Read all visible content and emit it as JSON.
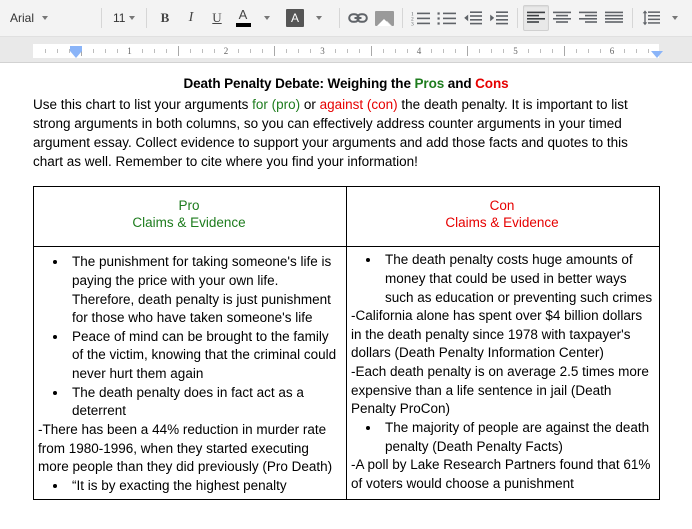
{
  "toolbar": {
    "font_name": "Arial",
    "font_size": "11",
    "bold_label": "B",
    "italic_label": "I",
    "underline_label": "U",
    "text_color_label": "A",
    "highlight_color_label": "A"
  },
  "ruler": {
    "numbers": [
      "1",
      "2",
      "3",
      "4",
      "5",
      "6"
    ]
  },
  "document": {
    "title_plain_1": "Death Penalty Debate: Weighing the ",
    "title_pros": "Pros",
    "title_plain_2": " and ",
    "title_cons": "Cons",
    "intro_1": "Use this chart to list your arguments ",
    "intro_pro": "for (pro)",
    "intro_2": " or ",
    "intro_con": "against (con)",
    "intro_3": " the death penalty. It is important to list strong arguments in both columns, so you can effectively address counter arguments in your timed argument essay. Collect evidence to support your arguments and add those facts and quotes to this chart as well. Remember to cite where you find your information!",
    "table": {
      "headers": [
        {
          "title": "Pro",
          "subtitle": "Claims & Evidence",
          "color": "#1e7c1e"
        },
        {
          "title": "Con",
          "subtitle": "Claims & Evidence",
          "color": "#e60000"
        }
      ],
      "pro_blocks": [
        {
          "type": "bullets",
          "items": [
            "The punishment for taking someone's life is paying the price with your own life. Therefore, death penalty is just punishment for those who have taken someone's life",
            "Peace of mind can be brought to the family of the victim, knowing that the criminal could never hurt them again",
            "The death penalty does in fact act as a deterrent"
          ]
        },
        {
          "type": "para",
          "text": "-There has been a 44% reduction in murder rate from 1980-1996, when they started executing more people than they did previously (Pro Death)"
        },
        {
          "type": "bullets",
          "items": [
            "“It is by exacting the highest penalty"
          ]
        }
      ],
      "con_blocks": [
        {
          "type": "bullets",
          "items": [
            "The death penalty costs huge amounts of money that could be used in better ways such as education or preventing such crimes"
          ]
        },
        {
          "type": "para",
          "text": "-California alone has spent over $4 billion dollars in the death penalty since 1978 with taxpayer's dollars (Death Penalty Information Center)"
        },
        {
          "type": "para",
          "text": "-Each death penalty is on average 2.5 times more expensive than a life sentence in jail (Death Penalty ProCon)"
        },
        {
          "type": "bullets",
          "items": [
            "The majority of people are against the death penalty (Death Penalty Facts)"
          ]
        },
        {
          "type": "para",
          "text": "-A poll by Lake Research Partners found that 61% of voters would choose a punishment"
        }
      ]
    }
  },
  "colors": {
    "pro_green": "#1e7c1e",
    "con_red": "#e60000",
    "ruler_marker_blue": "#8ab4f8",
    "toolbar_bg": "#f3f3f3"
  }
}
